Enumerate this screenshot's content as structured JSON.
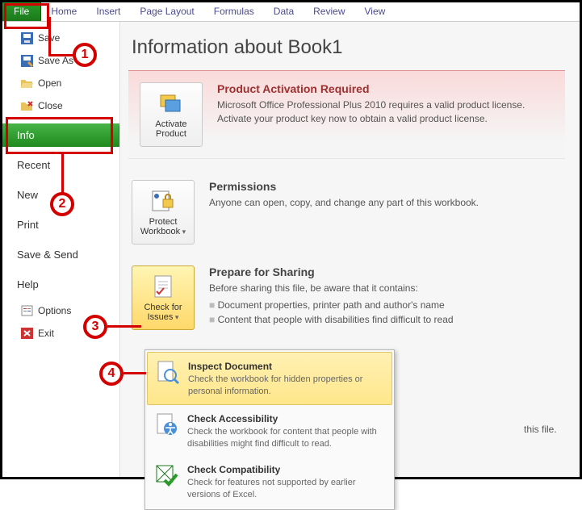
{
  "ribbon": {
    "file": "File",
    "tabs": [
      "Home",
      "Insert",
      "Page Layout",
      "Formulas",
      "Data",
      "Review",
      "View"
    ]
  },
  "sidebar": {
    "quick": [
      {
        "icon": "save",
        "label": "Save"
      },
      {
        "icon": "saveas",
        "label": "Save As"
      },
      {
        "icon": "open",
        "label": "Open"
      },
      {
        "icon": "close",
        "label": "Close"
      }
    ],
    "nav": [
      {
        "label": "Info",
        "active": true
      },
      {
        "label": "Recent"
      },
      {
        "label": "New"
      },
      {
        "label": "Print"
      },
      {
        "label": "Save & Send"
      },
      {
        "label": "Help"
      }
    ],
    "bottom": [
      {
        "icon": "options",
        "label": "Options"
      },
      {
        "icon": "exit",
        "label": "Exit"
      }
    ]
  },
  "main": {
    "title": "Information about Book1",
    "activation": {
      "btn": "Activate Product",
      "heading": "Product Activation Required",
      "body": "Microsoft Office Professional Plus 2010 requires a valid product license. Activate your product key now to obtain a valid product license."
    },
    "permissions": {
      "btn": "Protect Workbook",
      "heading": "Permissions",
      "body": "Anyone can open, copy, and change any part of this workbook."
    },
    "prepare": {
      "btn": "Check for Issues",
      "heading": "Prepare for Sharing",
      "intro": "Before sharing this file, be aware that it contains:",
      "items": [
        "Document properties, printer path and author's name",
        "Content that people with disabilities find difficult to read"
      ]
    },
    "versions_tail": "this file."
  },
  "dropdown": {
    "items": [
      {
        "title": "Inspect Document",
        "desc": "Check the workbook for hidden properties or personal information."
      },
      {
        "title": "Check Accessibility",
        "desc": "Check the workbook for content that people with disabilities might find difficult to read."
      },
      {
        "title": "Check Compatibility",
        "desc": "Check for features not supported by earlier versions of Excel."
      }
    ]
  },
  "callouts": {
    "c1": "1",
    "c2": "2",
    "c3": "3",
    "c4": "4"
  }
}
